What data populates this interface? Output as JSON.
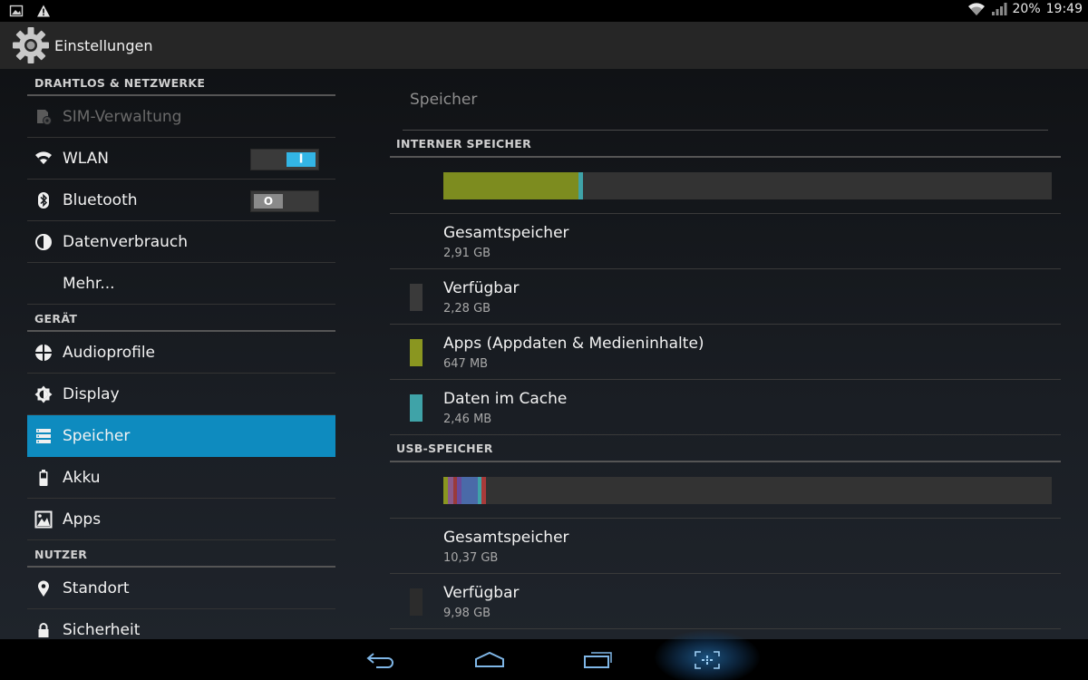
{
  "status_bar": {
    "battery": "20%",
    "time": "19:49",
    "icons": [
      "image-notification-icon",
      "warning-icon",
      "wifi-icon",
      "signal-icon"
    ]
  },
  "action_bar": {
    "title": "Einstellungen",
    "icon": "settings-gear-icon"
  },
  "sidebar": {
    "sections": [
      {
        "header": "DRAHTLOS & NETZWERKE",
        "items": [
          {
            "label": "SIM-Verwaltung",
            "icon": "sim-icon",
            "disabled": true
          },
          {
            "label": "WLAN",
            "icon": "wifi-icon",
            "toggle": "on",
            "toggle_text": "I"
          },
          {
            "label": "Bluetooth",
            "icon": "bluetooth-icon",
            "toggle": "off",
            "toggle_text": "O"
          },
          {
            "label": "Datenverbrauch",
            "icon": "data-usage-icon"
          },
          {
            "label": "Mehr...",
            "icon": ""
          }
        ]
      },
      {
        "header": "GERÄT",
        "items": [
          {
            "label": "Audioprofile",
            "icon": "audio-profile-icon"
          },
          {
            "label": "Display",
            "icon": "display-brightness-icon"
          },
          {
            "label": "Speicher",
            "icon": "storage-icon",
            "active": true
          },
          {
            "label": "Akku",
            "icon": "battery-icon"
          },
          {
            "label": "Apps",
            "icon": "apps-icon"
          }
        ]
      },
      {
        "header": "NUTZER",
        "items": [
          {
            "label": "Standort",
            "icon": "location-icon"
          },
          {
            "label": "Sicherheit",
            "icon": "lock-icon"
          }
        ]
      }
    ]
  },
  "content": {
    "title": "Speicher",
    "internal": {
      "header": "INTERNER SPEICHER",
      "bar_segments": [
        {
          "fraction": 0.222,
          "color": "#7d8c1f"
        },
        {
          "fraction": 0.008,
          "color": "#3fa3a8"
        }
      ],
      "items": [
        {
          "title": "Gesamtspeicher",
          "value": "2,91 GB",
          "swatch": ""
        },
        {
          "title": "Verfügbar",
          "value": "2,28 GB",
          "swatch": "#3a3a3a"
        },
        {
          "title": "Apps (Appdaten & Medieninhalte)",
          "value": "647 MB",
          "swatch": "#8a9620"
        },
        {
          "title": "Daten im Cache",
          "value": "2,46 MB",
          "swatch": "#3fa3a8"
        }
      ]
    },
    "usb": {
      "header": "USB-SPEICHER",
      "bar_segments": [
        {
          "fraction": 0.008,
          "color": "#8a9620"
        },
        {
          "fraction": 0.008,
          "color": "#8a5a8a"
        },
        {
          "fraction": 0.006,
          "color": "#9a3a3a"
        },
        {
          "fraction": 0.008,
          "color": "#6a4a9a"
        },
        {
          "fraction": 0.026,
          "color": "#4a6aa8"
        },
        {
          "fraction": 0.006,
          "color": "#3fa3a8"
        },
        {
          "fraction": 0.008,
          "color": "#a83a3a"
        }
      ],
      "items": [
        {
          "title": "Gesamtspeicher",
          "value": "10,37 GB",
          "swatch": ""
        },
        {
          "title": "Verfügbar",
          "value": "9,98 GB",
          "swatch": "#2c2c2c"
        }
      ]
    }
  },
  "nav_bar": {
    "buttons": [
      "back-icon",
      "home-icon",
      "recent-apps-icon",
      "screenshot-icon"
    ]
  },
  "colors": {
    "accent": "#0e8bbf",
    "toggle_on": "#33b5e5"
  }
}
